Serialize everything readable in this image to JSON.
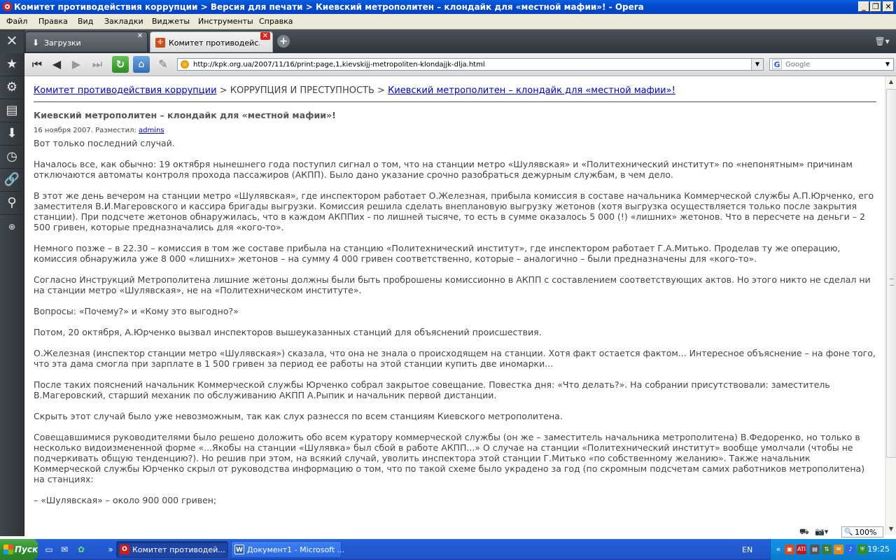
{
  "window": {
    "title": "Комитет противодействия коррупции > Версия для печати > Киевский метрополитен – клондайк для «местной мафии»! - Opera"
  },
  "menu": [
    "Файл",
    "Правка",
    "Вид",
    "Закладки",
    "Виджеты",
    "Инструменты",
    "Справка"
  ],
  "tabs": [
    {
      "label": "Загрузки",
      "icon": "download-icon"
    },
    {
      "label": "Комитет противодейс...",
      "icon": "site-favicon"
    }
  ],
  "address": {
    "url": "http://kpk.org.ua/2007/11/16/print:page,1,kievskijj-metropoliten-klondajjk-dlja.html",
    "search_placeholder": "Google"
  },
  "breadcrumb": {
    "home": "Комитет противодействия коррупции",
    "separator": ">",
    "section": "КОРРУПЦИЯ И ПРЕСТУПНОСТЬ",
    "current": "Киевский метрополитен – клондайк для «местной мафии»!"
  },
  "article": {
    "title": "Киевский метрополитен – клондайк для «местной мафии»!",
    "meta_prefix": "16 ноября 2007. Разместил:",
    "author": "admins",
    "paragraphs": [
      "Вот только последний случай.",
      "Началось все, как обычно: 19 октября нынешнего года поступил сигнал о том, что на станции метро «Шулявская» и «Политехнический институт» по «непонятным» причинам отключаются автоматы контроля прохода пассажиров (АКПП). Было дано указание срочно разобраться дежурным службам, в чем дело.",
      "В этот же день вечером на станции метро «Шулявская», где инспектором работает О.Железная, прибыла комиссия в составе начальника Коммерческой службы А.П.Юрченко, его заместителя В.И.Магеровского и кассира бригады выгрузки. Комиссия решила сделать внеплановую выгрузку жетонов (хотя выгрузка осуществляется только после закрытия станции). При подсчете жетонов обнаружилась, что в каждом АКППих - по лишней тысяче, то есть в сумме оказалось 5 000 (!) «лишних» жетонов. Что в пересчете на деньги – 2 500 гривен, которые предназначались для «кого-то».",
      "Немного позже – в 22.30 – комиссия в том же составе прибыла на станцию «Политехнический институт», где инспектором работает Г.А.Митько. Проделав ту же операцию, комиссия обнаружила уже 8 000 «лишних» жетонов – на сумму 4 000 гривен соответственно, которые – аналогично – были предназначены для «кого-то».",
      "Согласно Инструкций Метрополитена лишние жетоны должны были быть проброшены комиссионно в АКПП с составлением соответствующих актов. Но этого никто не сделал ни на станции метро «Шулявская», не на «Политехническом институте».",
      "Вопросы: «Почему?» и «Кому это выгодно?»",
      "Потом, 20 октября, А.Юрченко вызвал инспекторов вышеуказанных станций для объяснений происшествия.",
      "О.Железная (инспектор станции метро «Шулявская») сказала, что она не знала о происходящем на станции. Хотя факт остается фактом... Интересное объяснение – на фоне того, что эта дама смогла при зарплате в 1 500 гривен за период ее работы на этой станции купить две иномарки...",
      "После таких пояснений начальник Коммерческой службы Юрченко собрал закрытое совещание. Повестка дня: «Что делать?». На собрании присутствовали: заместитель В.Магеровский, старший механик по обслуживанию АКПП А.Рыпик и начальник первой дистанции.",
      "Скрыть этот случай было уже невозможным, так как слух разнесся по всем станциям Киевского метрополитена.",
      "Совещавшимися руководителями было решено доложить обо всем куратору коммерческой службы (он же – заместитель начальника метрополитена) В.Федоренко, но только в несколько видоизмененной форме «...Якобы на станции «Шулявка» был сбой в работе АКПП...» О случае на станции «Политехнический институт» вообще умолчали (чтобы не подчеркивать общую тенденцию?). Но решив при этом, на всякий случай, уволить инспектора этой станции Г.Митько «по собственному желанию». Также начальник Коммерческой службы Юрченко скрыл от руководства информацию о том, что по такой схеме было украдено за год (по скромным подсчетам самих работников метрополитена) на станциях:",
      "– «Шулявская» – около 900 000 гривен;"
    ]
  },
  "status": {
    "zoom": "100%"
  },
  "taskbar": {
    "start": "Пуск",
    "tasks": [
      {
        "label": "Комитет противодей...",
        "icon": "opera-icon",
        "active": true
      },
      {
        "label": "Документ1 - Microsoft ...",
        "icon": "word-icon",
        "active": false
      }
    ],
    "lang": "EN",
    "clock": "19:25"
  },
  "colors": {
    "link": "#0000cc",
    "titlebar": "#0448c9",
    "taskbar": "#245edb",
    "start": "#2f8f2f"
  }
}
